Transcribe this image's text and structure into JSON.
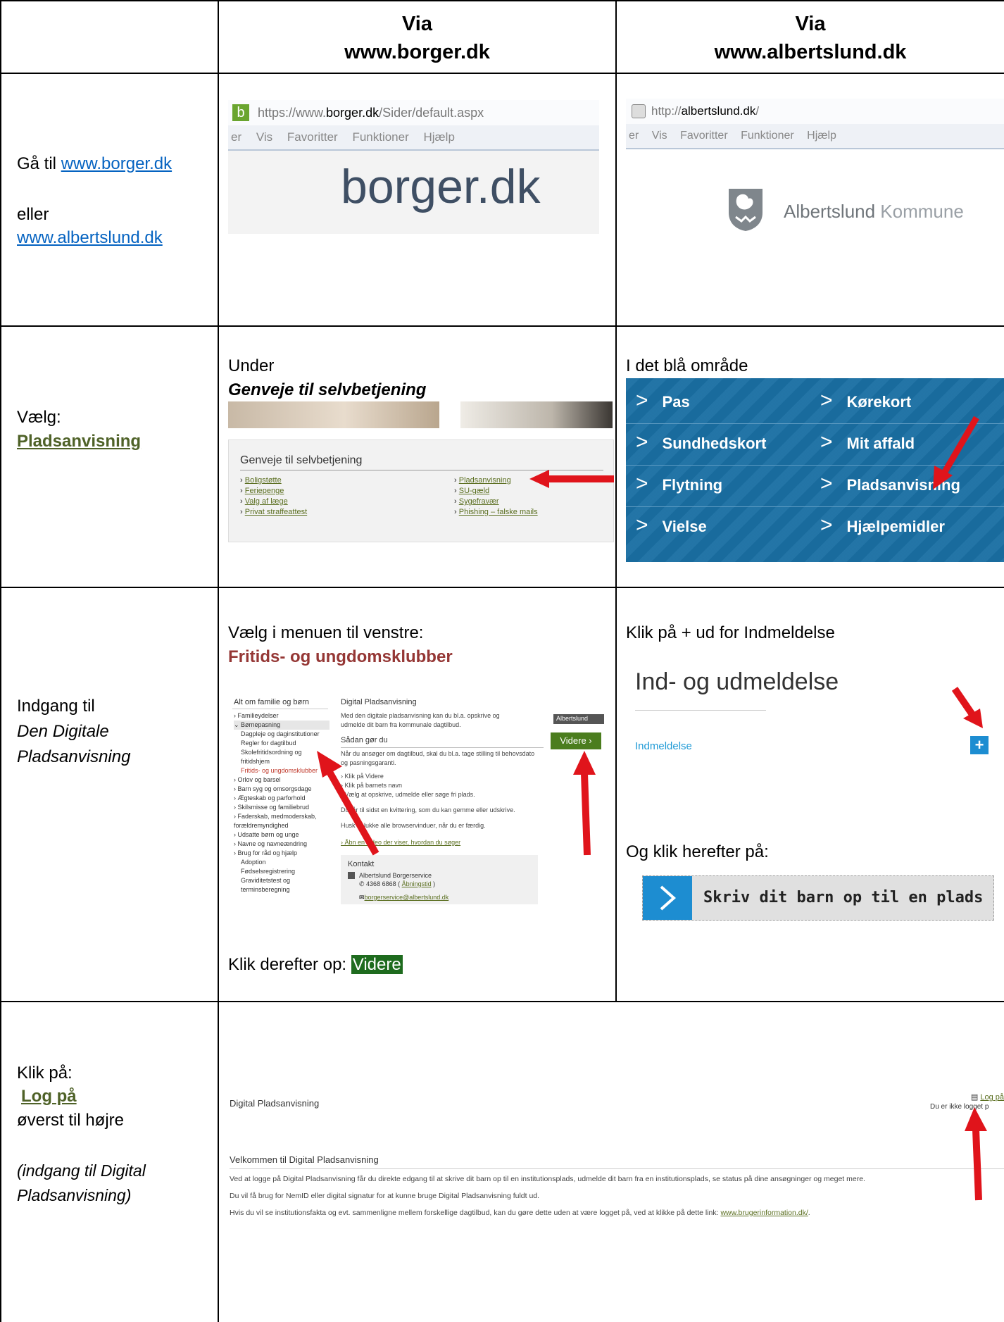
{
  "header": {
    "col2_line1": "Via",
    "col2_line2": "www.borger.dk",
    "col3_line1": "Via",
    "col3_line2": "www.albertslund.dk"
  },
  "row1": {
    "go_to": "Gå til ",
    "borger_link": "www.borger.dk",
    "or": "eller",
    "albertslund_link": "www.albertslund.dk",
    "borger_url_prefix": "https://www.",
    "borger_url_domain": "borger.dk",
    "borger_url_path": "/Sider/default.aspx",
    "borger_menu": [
      "er",
      "Vis",
      "Favoritter",
      "Funktioner",
      "Hjælp"
    ],
    "borger_logo_icon": "b",
    "borger_logo": "borger.dk",
    "alb_url_prefix": "http://",
    "alb_url_domain": "albertslund.dk",
    "alb_url_path": "/",
    "alb_menu": [
      "er",
      "Vis",
      "Favoritter",
      "Funktioner",
      "Hjælp"
    ],
    "alb_logo_strong": "Albertslund",
    "alb_logo_light": " Kommune"
  },
  "row2": {
    "choose": "Vælg:",
    "choose_item": "Pladsanvisning",
    "under": "Under",
    "shortcut_heading": "Genveje til selvbetjening",
    "box_title": "Genveje til selvbetjening",
    "left_links": [
      "Boligstøtte",
      "Feriepenge",
      "Valg af læge",
      "Privat straffeattest"
    ],
    "right_links": [
      "Pladsanvisning",
      "SU-gæld",
      "Sygefravær",
      "Phishing – falske mails"
    ],
    "blue_area": "I det blå område",
    "tiles_left": [
      "Pas",
      "Sundhedskort",
      "Flytning",
      "Vielse"
    ],
    "tiles_right": [
      "Kørekort",
      "Mit affald",
      "Pladsanvisning",
      "Hjælpemidler"
    ]
  },
  "row3": {
    "entry1": "Indgang til",
    "entry2": "Den Digitale",
    "entry3": "Pladsanvisning",
    "menu_instr": "Vælg i menuen til venstre:",
    "menu_target": "Fritids- og ungdomsklubber",
    "sidebar_title": "Alt om familie og børn",
    "sidebar_items": [
      "› Familieydelser",
      "⌄ Børnepasning",
      "Dagpleje og daginstitutioner",
      "Regler for dagtilbud",
      "Skolefritidsordning og fritidshjem",
      "Fritids- og ungdomsklubber",
      "› Orlov og barsel",
      "› Barn syg og omsorgsdage",
      "› Ægteskab og parforhold",
      "› Skilsmisse og familiebrud",
      "› Faderskab, medmoderskab, forældremyndighed",
      "› Udsatte børn og unge",
      "› Navne og navneændring",
      "› Brug for råd og hjælp",
      "Adoption",
      "Fødselsregistrering",
      "Graviditetstest og terminsberegning"
    ],
    "dp_title": "Digital Pladsanvisning",
    "dp_intro": "Med den digitale pladsanvisning kan du bl.a. opskrive og udmelde dit barn fra kommunale dagtilbud.",
    "dp_select": "Albertslund",
    "dp_how": "Sådan gør du",
    "dp_how_text": "Når du ansøger om dagtilbud, skal du bl.a. tage stilling til behovsdato og pasningsgaranti.",
    "dp_steps": [
      "› Klik på Videre",
      "› Klik på barnets navn",
      "› Vælg at opskrive, udmelde eller søge fri plads."
    ],
    "dp_receipt": "Du får til sidst en kvittering, som du kan gemme eller udskrive.",
    "dp_close": "Husk at lukke alle browservinduer, når du er færdig.",
    "dp_video": "› Åbn en video der viser, hvordan du søger",
    "videre_btn": "Videre ›",
    "contact_title": "Kontakt",
    "contact_name": "Albertslund Borgerservice",
    "contact_phone": "4368 6868",
    "contact_hours": "Åbningstid",
    "contact_mail": "borgerservice@albertslund.dk",
    "then_click": "Klik derefter op: ",
    "then_target": "Videre",
    "plus_instr": "Klik på + ud for Indmeldelse",
    "ind_heading": "Ind- og udmeldelse",
    "ind_link": "Indmeldelse",
    "plus": "+",
    "then_click2": "Og klik herefter på:",
    "write_child": "Skriv dit barn op til en plads"
  },
  "row4": {
    "click": "Klik på:",
    "login": "Log på",
    "top_right": "øverst til højre",
    "note1": "(indgang til Digital",
    "note2": "Pladsanvisning)",
    "dp_title": "Digital Pladsanvisning",
    "login_link": "Log på",
    "not_logged": "Du er ikke logget p",
    "welcome": "Velkommen til Digital Pladsanvisning",
    "p1": "Ved at logge på Digital Pladsanvisning får du direkte edgang til at skrive dit barn op til en institutionsplads, udmelde dit barn fra en institutionsplads, se status på dine ansøgninger og meget mere.",
    "p2": "Du vil få brug for NemID eller digital signatur for at kunne bruge Digital Pladsanvisning fuldt ud.",
    "p3_pre": "Hvis du vil se institutionsfakta og evt. sammenligne mellem forskellige dagtilbud, kan du gøre dette uden at være logget på, ved at klikke på dette link: ",
    "p3_link": "www.brugerinformation.dk/",
    "p3_post": "."
  }
}
